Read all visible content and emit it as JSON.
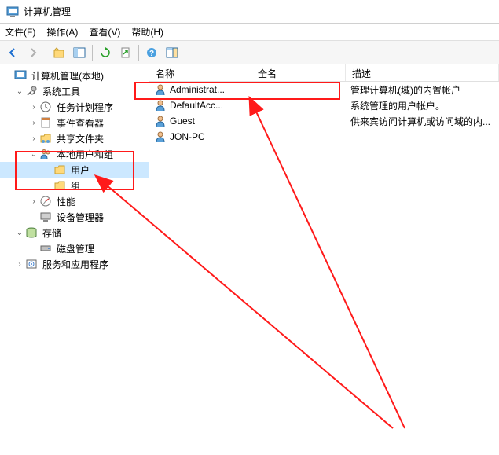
{
  "window": {
    "title": "计算机管理"
  },
  "menu": {
    "file": "文件(F)",
    "action": "操作(A)",
    "view": "查看(V)",
    "help": "帮助(H)"
  },
  "tree": {
    "root": "计算机管理(本地)",
    "system_tools": "系统工具",
    "task_scheduler": "任务计划程序",
    "event_viewer": "事件查看器",
    "shared_folders": "共享文件夹",
    "local_users_groups": "本地用户和组",
    "users": "用户",
    "groups": "组",
    "performance": "性能",
    "device_manager": "设备管理器",
    "storage": "存储",
    "disk_management": "磁盘管理",
    "services_apps": "服务和应用程序"
  },
  "columns": {
    "name": "名称",
    "fullname": "全名",
    "description": "描述"
  },
  "users": [
    {
      "name": "Administrat...",
      "fullname": "",
      "desc": "管理计算机(域)的内置帐户"
    },
    {
      "name": "DefaultAcc...",
      "fullname": "",
      "desc": "系统管理的用户帐户。"
    },
    {
      "name": "Guest",
      "fullname": "",
      "desc": "供来宾访问计算机或访问域的内..."
    },
    {
      "name": "JON-PC",
      "fullname": "",
      "desc": ""
    }
  ]
}
